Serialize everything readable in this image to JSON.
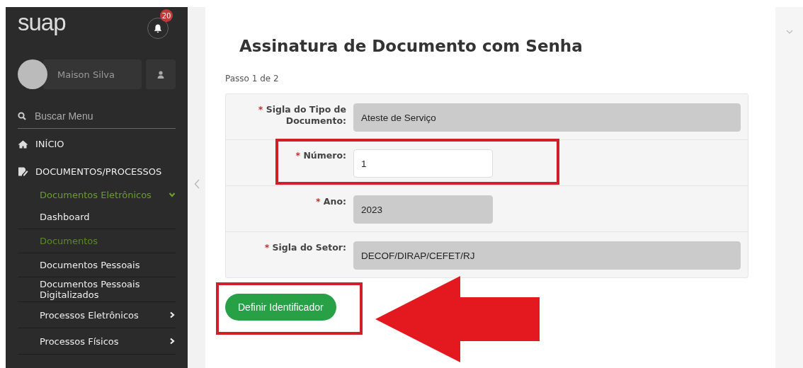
{
  "sidebar": {
    "logo": "suap",
    "notifications": "20",
    "user": {
      "name": "Maison Silva"
    },
    "search": {
      "placeholder": "Buscar Menu"
    },
    "items": [
      {
        "label": "INÍCIO"
      },
      {
        "label": "DOCUMENTOS/PROCESSOS",
        "children": [
          {
            "label": "Documentos Eletrônicos",
            "selected": true,
            "expanded": true,
            "children": [
              {
                "label": "Dashboard",
                "selected": false
              },
              {
                "label": "Documentos",
                "selected": true
              },
              {
                "label": "Documentos Pessoais",
                "selected": false
              },
              {
                "label": "Documentos Pessoais Digitalizados",
                "selected": false
              }
            ]
          },
          {
            "label": "Processos Eletrônicos",
            "selected": false,
            "expanded": false
          },
          {
            "label": "Processos Físicos",
            "selected": false,
            "expanded": false
          }
        ]
      }
    ]
  },
  "page": {
    "title": "Assinatura de Documento com Senha",
    "step": "Passo 1 de 2",
    "fields": [
      {
        "label": "Sigla do Tipo de Documento:",
        "required_mark": "*",
        "value": "Ateste de Serviço",
        "disabled": true,
        "wide": true,
        "highlighted": false
      },
      {
        "label": "Número:",
        "required_mark": "*",
        "value": "1",
        "disabled": false,
        "wide": false,
        "highlighted": true
      },
      {
        "label": "Ano:",
        "required_mark": "*",
        "value": "2023",
        "disabled": true,
        "wide": false,
        "highlighted": false
      },
      {
        "label": "Sigla do Setor:",
        "required_mark": "*",
        "value": "DECOF/DIRAP/CEFET/RJ",
        "disabled": true,
        "wide": true,
        "highlighted": false
      }
    ],
    "button": {
      "label": "Definir Identificador",
      "highlighted": true
    }
  }
}
